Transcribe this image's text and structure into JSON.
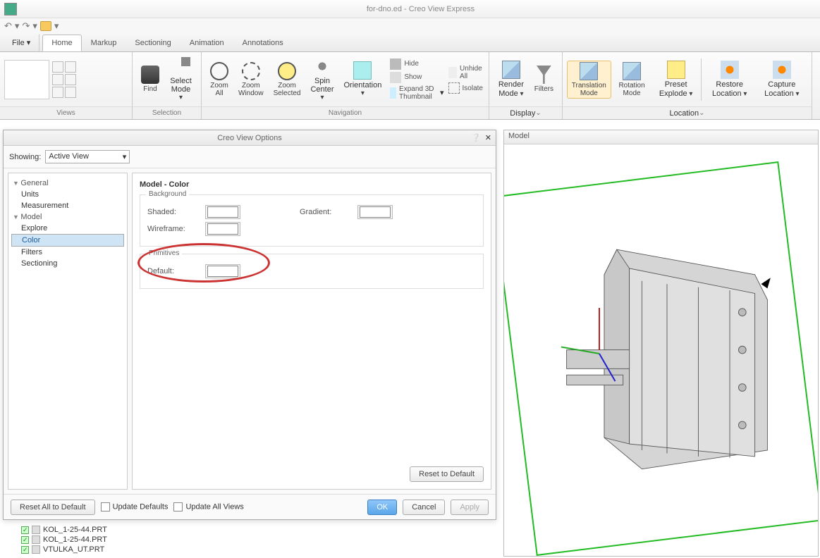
{
  "app": {
    "title": "for-dno.ed - Creo View Express"
  },
  "qat": {
    "undo": "↶",
    "redo": "↷"
  },
  "tabs": {
    "file": "File",
    "items": [
      "Home",
      "Markup",
      "Sectioning",
      "Animation",
      "Annotations"
    ],
    "active": 0
  },
  "ribbon": {
    "views": {
      "label": "Views"
    },
    "selection": {
      "label": "Selection",
      "find": "Find",
      "select_mode": "Select\nMode"
    },
    "navigation": {
      "label": "Navigation",
      "zoom_all": "Zoom\nAll",
      "zoom_window": "Zoom\nWindow",
      "zoom_selected": "Zoom\nSelected",
      "spin_center": "Spin\nCenter",
      "orientation": "Orientation",
      "hide": "Hide",
      "show": "Show",
      "expand": "Expand 3D Thumbnail",
      "unhide": "Unhide All",
      "isolate": "Isolate"
    },
    "display": {
      "label": "Display",
      "render_mode": "Render\nMode",
      "filters": "Filters"
    },
    "location": {
      "label": "Location",
      "translation": "Translation\nMode",
      "rotation": "Rotation\nMode",
      "preset": "Preset\nExplode",
      "restore": "Restore\nLocation",
      "capture": "Capture\nLocation"
    }
  },
  "dialog": {
    "title": "Creo View Options",
    "showing_label": "Showing:",
    "showing_value": "Active View",
    "tree": {
      "general": {
        "label": "General",
        "children": [
          "Units",
          "Measurement"
        ]
      },
      "model": {
        "label": "Model",
        "children": [
          "Explore",
          "Color",
          "Filters",
          "Sectioning"
        ],
        "selected": "Color"
      }
    },
    "panel": {
      "title": "Model - Color",
      "background": {
        "legend": "Background",
        "shaded": "Shaded:",
        "wireframe": "Wireframe:",
        "gradient": "Gradient:"
      },
      "primitives": {
        "legend": "Primitives",
        "default": "Default:"
      },
      "reset": "Reset to Default"
    },
    "footer": {
      "reset_all": "Reset All to Default",
      "update_defaults": "Update Defaults",
      "update_views": "Update All Views",
      "ok": "OK",
      "cancel": "Cancel",
      "apply": "Apply"
    }
  },
  "model_panel": {
    "title": "Model"
  },
  "file_tree": {
    "items": [
      "KOL_1-25-44.PRT",
      "KOL_1-25-44.PRT",
      "VTULKA_UT.PRT"
    ]
  }
}
